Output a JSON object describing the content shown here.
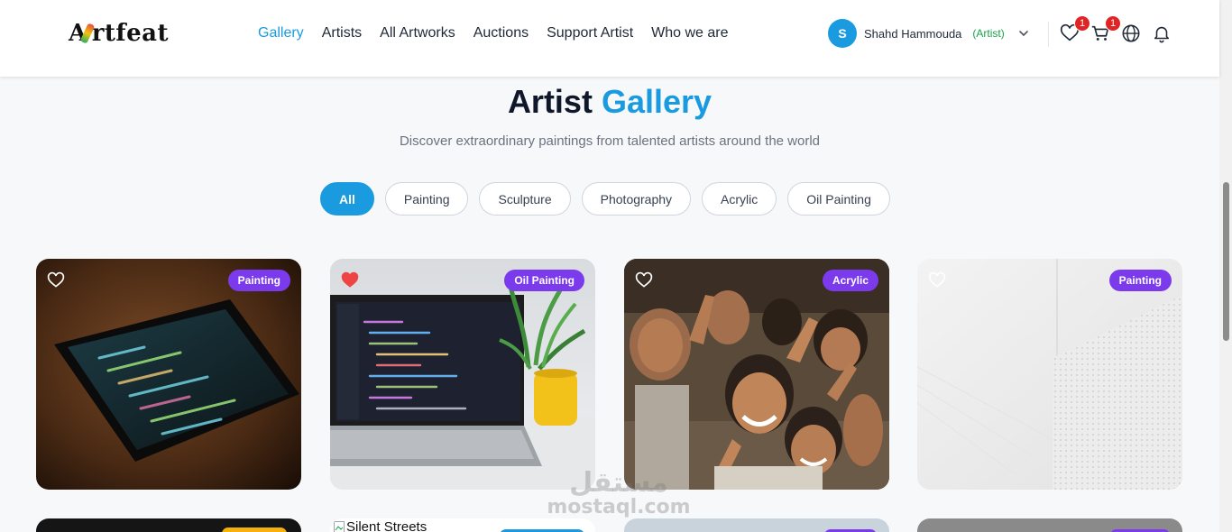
{
  "brand": {
    "name": "rtfeat",
    "initial": "A"
  },
  "nav": [
    "Gallery",
    "Artists",
    "All Artworks",
    "Auctions",
    "Support Artist",
    "Who we are"
  ],
  "user": {
    "avatar_initial": "S",
    "name": "Shahd Hammouda",
    "role": "(Artist)"
  },
  "header_icons": {
    "wishlist_count": "1",
    "cart_count": "1"
  },
  "hero": {
    "title_main": "Artist",
    "title_accent": "Gallery",
    "subtitle": "Discover extraordinary paintings from talented artists around the world"
  },
  "filters": [
    "All",
    "Painting",
    "Sculpture",
    "Photography",
    "Acrylic",
    "Oil Painting"
  ],
  "active_filter": "All",
  "artworks": [
    {
      "category": "Painting",
      "favorited": false,
      "image": "smartphone with code"
    },
    {
      "category": "Oil Painting",
      "favorited": true,
      "image": "laptop with code and yellow mug"
    },
    {
      "category": "Acrylic",
      "favorited": false,
      "image": "group of smiling children"
    },
    {
      "category": "Painting",
      "favorited": false,
      "image": "white wall texture"
    }
  ],
  "second_row": {
    "broken_image_alt": "Silent Streets"
  },
  "watermark": {
    "arabic": "مستقل",
    "latin": "mostaql.com"
  },
  "colors": {
    "accent": "#1a9be0",
    "tag": "#7c3aed",
    "badge": "#e02424",
    "role": "#16a34a"
  }
}
